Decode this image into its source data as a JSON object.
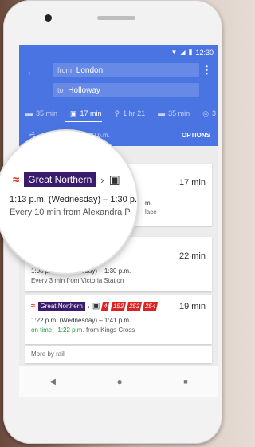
{
  "status": {
    "time": "12:30"
  },
  "search": {
    "from_prefix": "from",
    "from": "London",
    "to_prefix": "to",
    "to": "Holloway"
  },
  "modes": [
    {
      "label": "35 min",
      "icon": "car-icon"
    },
    {
      "label": "17 min",
      "icon": "transit-icon",
      "active": true
    },
    {
      "label": "1 hr 21",
      "icon": "walk-icon"
    },
    {
      "label": "35 min",
      "icon": "taxi-icon"
    },
    {
      "label": "3",
      "icon": "bike-icon"
    }
  ],
  "depart": {
    "text": "Depart at 12:30 p.m.",
    "options": "OPTIONS"
  },
  "routes": [
    {
      "operator": "Great Northern",
      "duration": "17 min",
      "times": "1:13 p.m. (Wednesday) – 1:30 p.m.",
      "frequency": "Every 10 min from Alexandra Palace"
    },
    {
      "duration": "22 min",
      "times": "1:08 p.m. (Wednesday) – 1:30 p.m.",
      "frequency": "Every 3 min from Victoria Station"
    },
    {
      "operator": "Great Northern",
      "bus_numbers": [
        "4",
        "153",
        "253",
        "254"
      ],
      "duration": "19 min",
      "times": "1:22 p.m. (Wednesday) – 1:41 p.m.",
      "on_time": "on time · 1:22 p.m.",
      "from": "from Kings Cross"
    }
  ],
  "magnifier": {
    "operator": "Great Northern",
    "times": "1:13 p.m. (Wednesday) – 1:30 p.m.",
    "frequency": "Every 10 min from Alexandra P"
  },
  "more": "More by rail",
  "colors": {
    "app_bar": "#4a74e2",
    "operator_badge": "#3b1b6b",
    "rail": "#d23b2f",
    "on_time": "#1e9e3a"
  }
}
